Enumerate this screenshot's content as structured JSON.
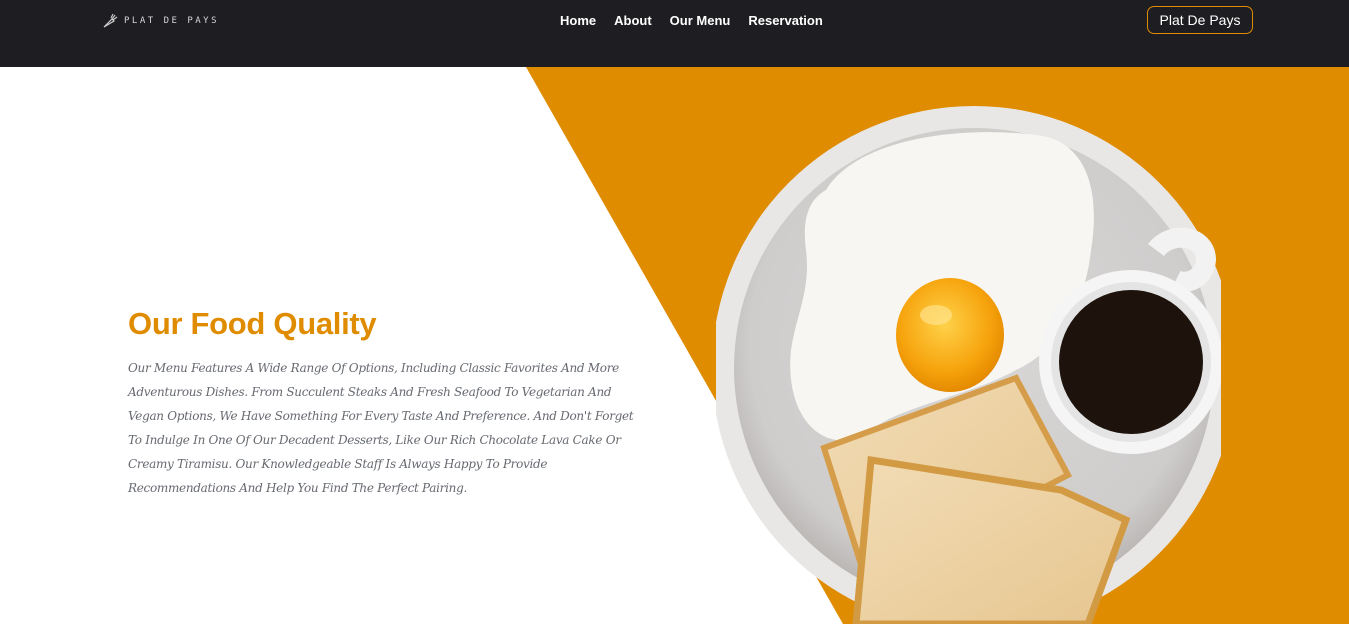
{
  "header": {
    "brand": "PLAT DE PAYS",
    "nav": [
      "Home",
      "About",
      "Our Menu",
      "Reservation"
    ],
    "cta_label": "Plat De Pays"
  },
  "hero": {
    "title": "Our Food Quality",
    "description": "Our Menu Features A Wide Range Of Options, Including Classic Favorites And More Adventurous Dishes. From Succulent Steaks And Fresh Seafood To Vegetarian And Vegan Options, We Have Something For Every Taste And Preference. And Don't Forget To Indulge In One Of Our Decadent Desserts, Like Our Rich Chocolate Lava Cake Or Creamy Tiramisu. Our Knowledgeable Staff Is Always Happy To Provide Recommendations And Help You Find The Perfect Pairing.",
    "image": "plate-with-fried-egg-toast-and-coffee"
  },
  "colors": {
    "accent": "#e08c00",
    "header_bg": "#1e1e22",
    "text": "#666a70"
  },
  "icons": {
    "logo": "carrot-icon"
  }
}
